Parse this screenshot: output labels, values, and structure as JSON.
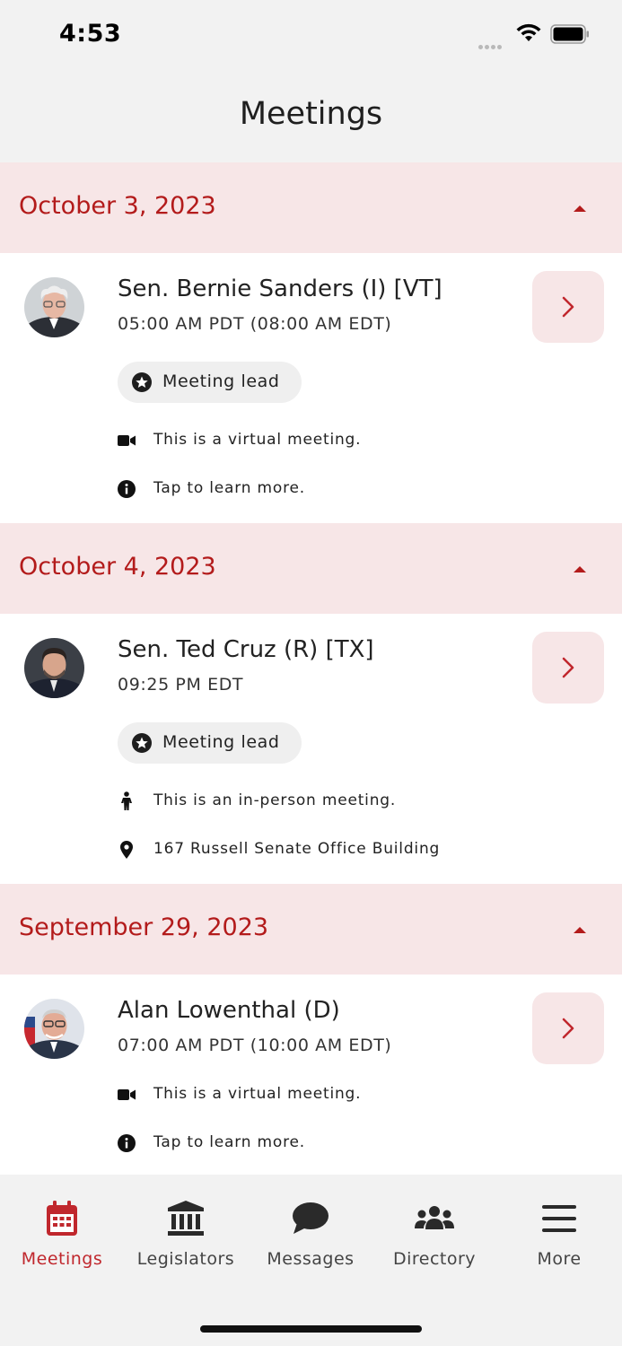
{
  "status_bar": {
    "time": "4:53"
  },
  "header": {
    "title": "Meetings"
  },
  "sections": [
    {
      "date": "October 3, 2023",
      "meeting": {
        "name": "Sen. Bernie Sanders (I) [VT]",
        "time": "05:00 AM PDT (08:00 AM EDT)",
        "lead_label": "Meeting lead",
        "detail_1": {
          "icon": "video-camera-icon",
          "text": "This is a virtual meeting."
        },
        "detail_2": {
          "icon": "info-icon",
          "text": "Tap to learn more."
        }
      }
    },
    {
      "date": "October 4, 2023",
      "meeting": {
        "name": "Sen. Ted Cruz (R) [TX]",
        "time": "09:25 PM EDT",
        "lead_label": "Meeting lead",
        "detail_1": {
          "icon": "person-icon",
          "text": "This is an in-person meeting."
        },
        "detail_2": {
          "icon": "location-pin-icon",
          "text": "167 Russell Senate Office Building"
        }
      }
    },
    {
      "date": "September 29, 2023",
      "meeting": {
        "name": "Alan Lowenthal (D)",
        "time": "07:00 AM PDT (10:00 AM EDT)",
        "detail_1": {
          "icon": "video-camera-icon",
          "text": "This is a virtual meeting."
        },
        "detail_2": {
          "icon": "info-icon",
          "text": "Tap to learn more."
        }
      }
    }
  ],
  "tabs": [
    {
      "label": "Meetings",
      "icon": "calendar-icon",
      "active": true
    },
    {
      "label": "Legislators",
      "icon": "capitol-building-icon"
    },
    {
      "label": "Messages",
      "icon": "chat-bubble-icon"
    },
    {
      "label": "Directory",
      "icon": "people-group-icon"
    },
    {
      "label": "More",
      "icon": "hamburger-menu-icon"
    }
  ],
  "colors": {
    "accent": "#b31b1b",
    "section_bg": "#f7e6e7",
    "chip_bg": "#efefef"
  }
}
